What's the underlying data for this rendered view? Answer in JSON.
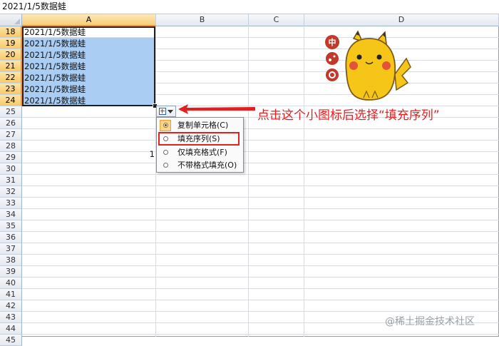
{
  "formula_bar": {
    "value": "2021/1/5数据蛙"
  },
  "columns": [
    {
      "label": "A",
      "selected": true
    },
    {
      "label": "B",
      "selected": false
    },
    {
      "label": "C",
      "selected": false
    },
    {
      "label": "D",
      "selected": false
    }
  ],
  "rows": [
    {
      "num": "18",
      "selected": true,
      "a": "2021/1/5数据蛙",
      "a_selected": false
    },
    {
      "num": "19",
      "selected": true,
      "a": "2021/1/5数据蛙",
      "a_selected": true
    },
    {
      "num": "20",
      "selected": true,
      "a": "2021/1/5数据蛙",
      "a_selected": true
    },
    {
      "num": "21",
      "selected": true,
      "a": "2021/1/5数据蛙",
      "a_selected": true
    },
    {
      "num": "22",
      "selected": true,
      "a": "2021/1/5数据蛙",
      "a_selected": true
    },
    {
      "num": "23",
      "selected": true,
      "a": "2021/1/5数据蛙",
      "a_selected": true
    },
    {
      "num": "24",
      "selected": true,
      "a": "2021/1/5数据蛙",
      "a_selected": true
    },
    {
      "num": "25"
    },
    {
      "num": "26"
    },
    {
      "num": "27"
    },
    {
      "num": "28"
    },
    {
      "num": "29"
    },
    {
      "num": "30"
    },
    {
      "num": "31"
    },
    {
      "num": "32"
    },
    {
      "num": "33"
    },
    {
      "num": "34"
    },
    {
      "num": "35"
    },
    {
      "num": "36"
    },
    {
      "num": "37"
    },
    {
      "num": "38"
    },
    {
      "num": "39"
    },
    {
      "num": "40"
    },
    {
      "num": "41"
    },
    {
      "num": "42"
    },
    {
      "num": "43"
    },
    {
      "num": "44"
    },
    {
      "num": "45"
    }
  ],
  "stray_value": "1",
  "autofill_menu": {
    "items": [
      {
        "label": "复制单元格(C)",
        "checked": true
      },
      {
        "label": "填充序列(S)",
        "checked": false,
        "highlighted": true
      },
      {
        "label": "仅填充格式(F)",
        "checked": false
      },
      {
        "label": "不带格式填充(O)",
        "checked": false
      }
    ]
  },
  "annotation": "点击这个小图标后选择“填充序列”",
  "mascot_badges": [
    "中"
  ],
  "watermark": "@稀土掘金技术社区",
  "colors": {
    "selection": "#a9cdf3",
    "header_selected": "#f8cf78",
    "annotation": "#e51f1f"
  }
}
